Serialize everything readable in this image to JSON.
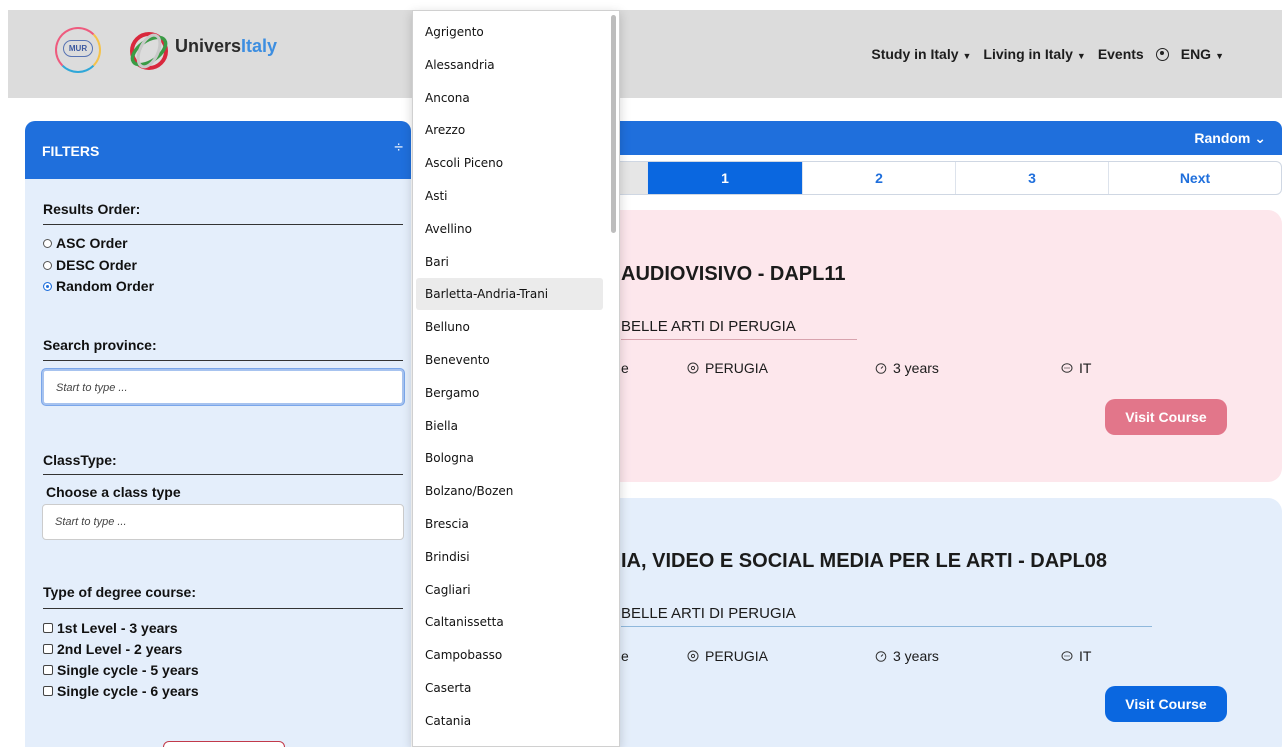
{
  "header": {
    "mur_logo_text": "MUR",
    "brand_part1": "Univers",
    "brand_part2": "Italy",
    "nav": [
      {
        "label": "Study in Italy"
      },
      {
        "label": "Living in Italy"
      },
      {
        "label": "Events"
      },
      {
        "label": "ENG"
      }
    ]
  },
  "filters": {
    "title": "FILTERS",
    "results_order_label": "Results Order:",
    "order_options": [
      {
        "label": "ASC Order",
        "checked": false
      },
      {
        "label": "DESC Order",
        "checked": false
      },
      {
        "label": "Random Order",
        "checked": true
      }
    ],
    "search_province_label": "Search province:",
    "search_province_placeholder": "Start to type ...",
    "classtype_label": "ClassType:",
    "choose_class_label": "Choose a class type",
    "class_placeholder": "Start to type ...",
    "degree_type_label": "Type of degree course:",
    "degree_options": [
      {
        "label": "1st Level - 3 years"
      },
      {
        "label": "2nd Level - 2 years"
      },
      {
        "label": "Single cycle - 5 years"
      },
      {
        "label": "Single cycle - 6 years"
      }
    ]
  },
  "sort": {
    "value": "Random"
  },
  "pagination": {
    "pages": [
      "1",
      "2",
      "3"
    ],
    "next": "Next",
    "active": "1"
  },
  "courses": [
    {
      "title": "AUDIOVISIVO - DAPL11",
      "institution": "BELLE ARTI DI PERUGIA",
      "type_fragment": "e",
      "city": "PERUGIA",
      "duration": "3 years",
      "language": "IT",
      "button": "Visit Course"
    },
    {
      "title": "IA, VIDEO E SOCIAL MEDIA PER LE ARTI - DAPL08",
      "institution": "BELLE ARTI DI PERUGIA",
      "type_fragment": "e",
      "city": "PERUGIA",
      "duration": "3 years",
      "language": "IT",
      "button": "Visit Course"
    }
  ],
  "province_dropdown": {
    "hovered": "Barletta-Andria-Trani",
    "items": [
      "Agrigento",
      "Alessandria",
      "Ancona",
      "Arezzo",
      "Ascoli Piceno",
      "Asti",
      "Avellino",
      "Bari",
      "Barletta-Andria-Trani",
      "Belluno",
      "Benevento",
      "Bergamo",
      "Biella",
      "Bologna",
      "Bolzano/Bozen",
      "Brescia",
      "Brindisi",
      "Cagliari",
      "Caltanissetta",
      "Campobasso",
      "Caserta",
      "Catania"
    ]
  },
  "colors": {
    "primary_blue": "#1f6fdc",
    "pink_card": "#fde7ec",
    "blue_card": "#e4eefb",
    "pink_button": "#e2768a",
    "blue_button": "#0a67e0"
  }
}
